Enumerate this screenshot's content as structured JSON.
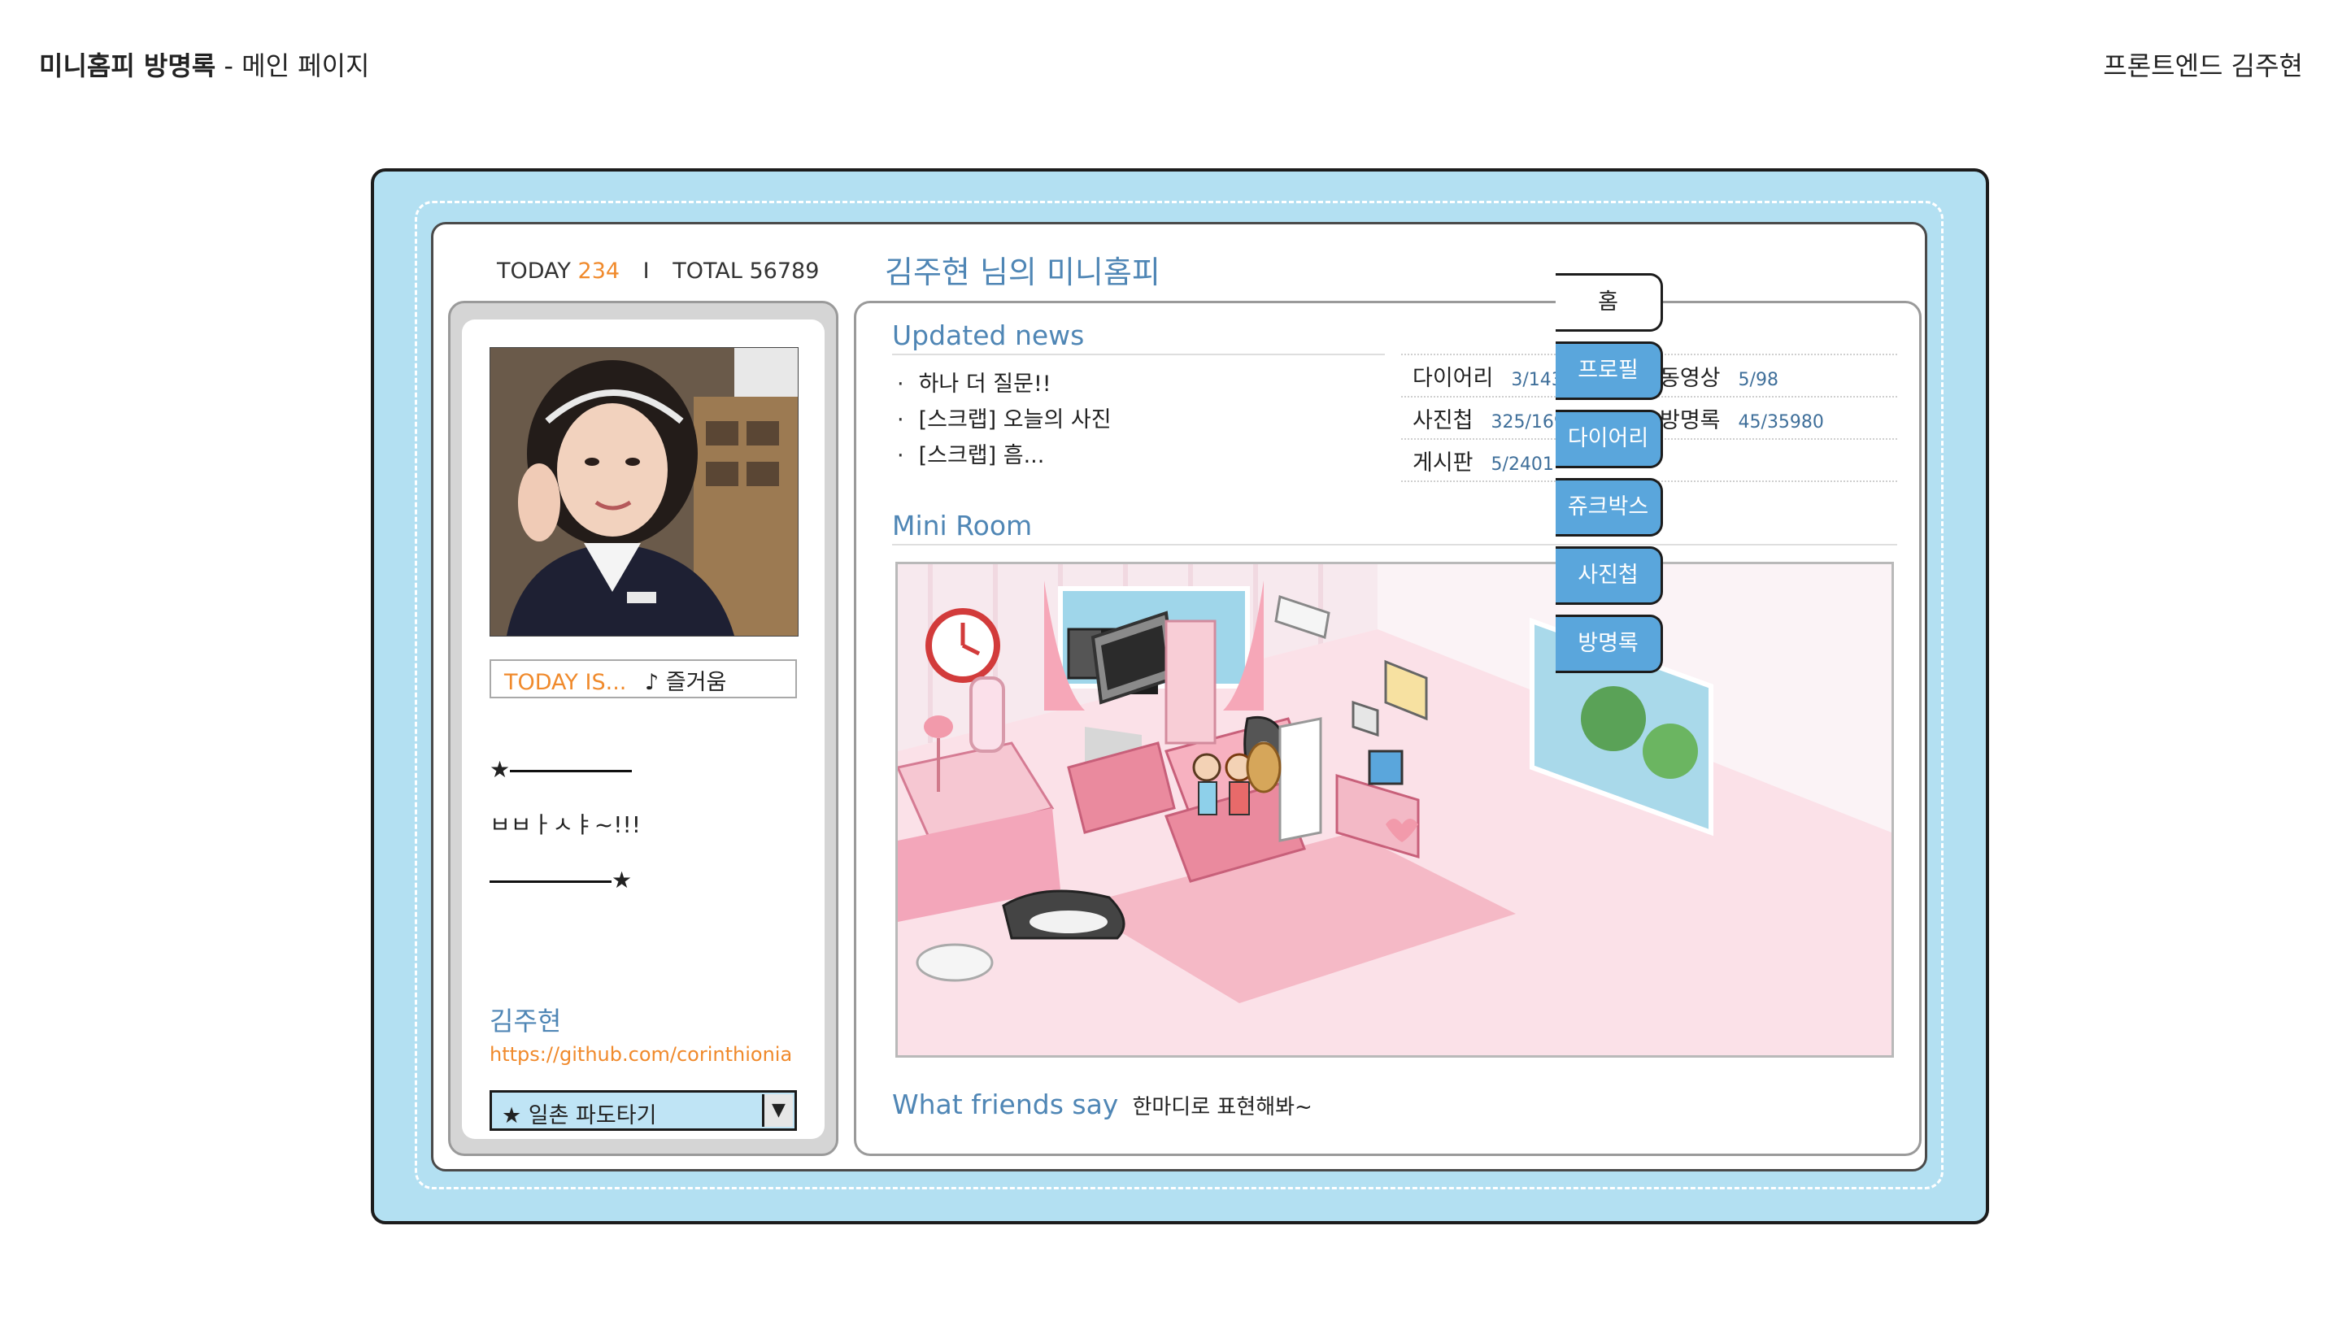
{
  "header": {
    "title_bold": "미니홈피 방명록",
    "title_rest": "- 메인 페이지",
    "author": "프론트엔드 김주현"
  },
  "counter": {
    "today_label": "TODAY",
    "today_value": "234",
    "separator": "I",
    "total_label": "TOTAL",
    "total_value": "56789"
  },
  "home_title": "김주현 님의 미니홈피",
  "profile": {
    "today_is_label": "TODAY IS...",
    "mood": "♪ 즐거움",
    "intro_star": "★",
    "intro_text": "ㅂㅂㅏㅅㅑ~!!!",
    "intro_star_end": "★",
    "name": "김주현",
    "url": "https://github.com/corinthionia",
    "wave_option": "★ 일촌 파도타기",
    "wave_arrow": "▼"
  },
  "news": {
    "title": "Updated news",
    "bullet": "·",
    "items": [
      "하나 더 질문!!",
      "[스크랩] 오늘의 사진",
      "[스크랩] 흠..."
    ]
  },
  "stats": [
    {
      "label": "다이어리",
      "count": "3/143"
    },
    {
      "label": "동영상",
      "count": "5/98"
    },
    {
      "label": "사진첩",
      "count": "325/1694"
    },
    {
      "label": "방명록",
      "count": "45/35980"
    },
    {
      "label": "게시판",
      "count": "5/2401"
    }
  ],
  "mini_room": {
    "title": "Mini Room"
  },
  "friends": {
    "title": "What friends say",
    "subtitle": "한마디로 표현해봐~"
  },
  "tabs": [
    "홈",
    "프로필",
    "다이어리",
    "쥬크박스",
    "사진첩",
    "방명록"
  ],
  "colors": {
    "frame": "#b3e0f2",
    "tab_blue": "#5aa6dc",
    "title_blue": "#4f86b5",
    "accent_orange": "#f08a2c"
  }
}
